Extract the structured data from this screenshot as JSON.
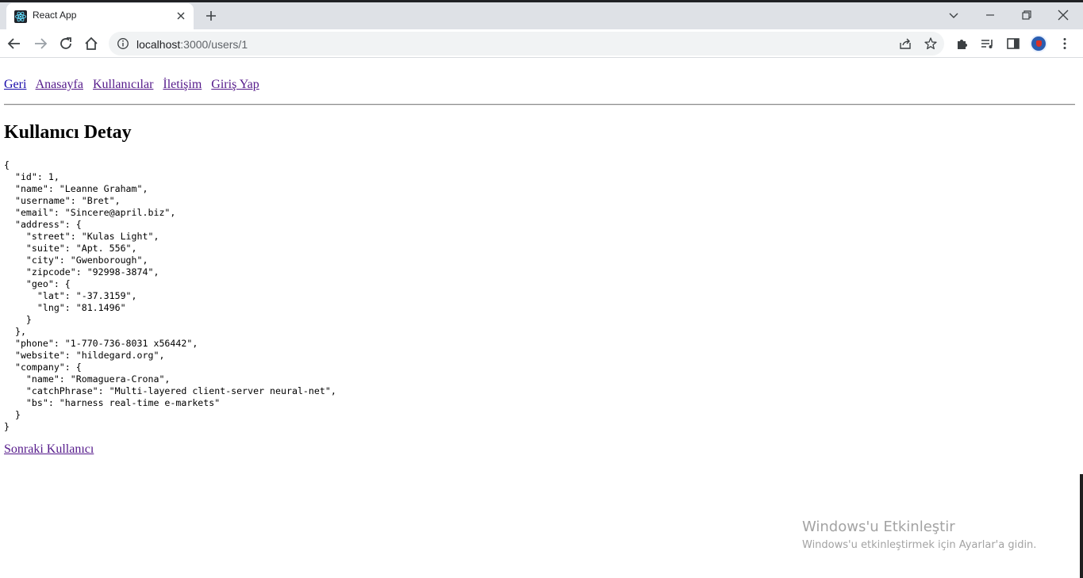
{
  "browser": {
    "tab_title": "React App",
    "url_host": "localhost",
    "url_rest": ":3000/users/1"
  },
  "nav": {
    "back": "Geri",
    "home": "Anasayfa",
    "users": "Kullanıcılar",
    "contact": "İletişim",
    "login": "Giriş Yap"
  },
  "page": {
    "heading": "Kullanıcı Detay",
    "json": "{\n  \"id\": 1,\n  \"name\": \"Leanne Graham\",\n  \"username\": \"Bret\",\n  \"email\": \"Sincere@april.biz\",\n  \"address\": {\n    \"street\": \"Kulas Light\",\n    \"suite\": \"Apt. 556\",\n    \"city\": \"Gwenborough\",\n    \"zipcode\": \"92998-3874\",\n    \"geo\": {\n      \"lat\": \"-37.3159\",\n      \"lng\": \"81.1496\"\n    }\n  },\n  \"phone\": \"1-770-736-8031 x56442\",\n  \"website\": \"hildegard.org\",\n  \"company\": {\n    \"name\": \"Romaguera-Crona\",\n    \"catchPhrase\": \"Multi-layered client-server neural-net\",\n    \"bs\": \"harness real-time e-markets\"\n  }\n}",
    "next_link": "Sonraki Kullanıcı"
  },
  "watermark": {
    "title": "Windows'u Etkinleştir",
    "subtitle": "Windows'u etkinleştirmek için Ayarlar'a gidin."
  }
}
